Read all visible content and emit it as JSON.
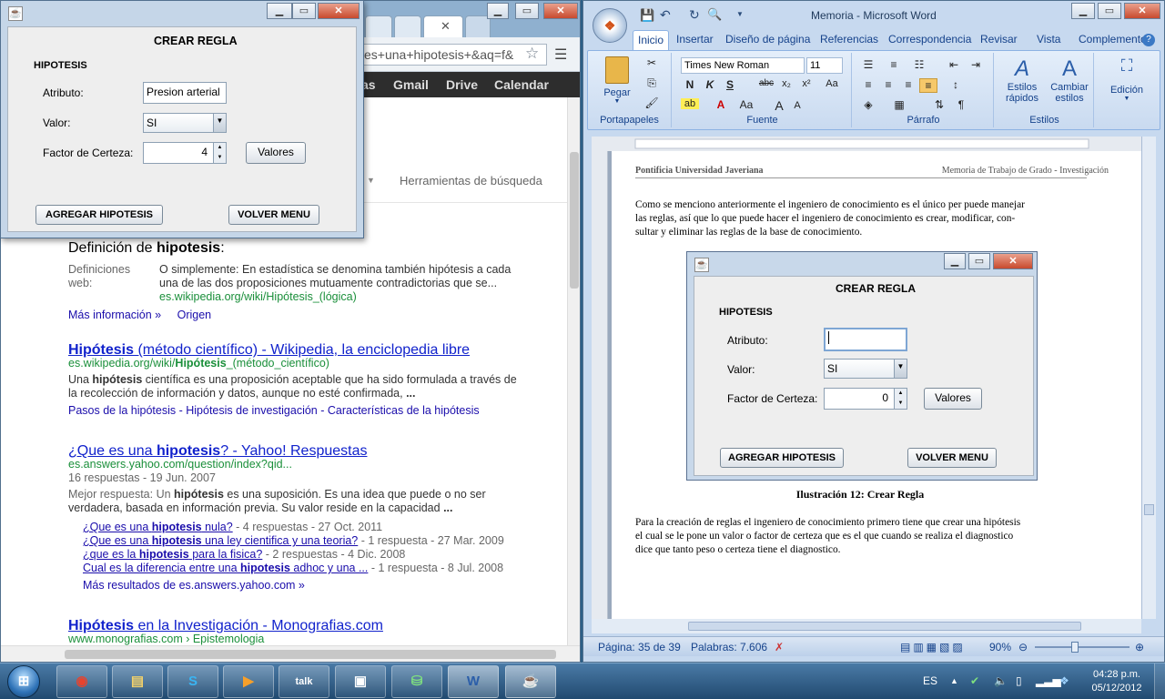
{
  "chrome": {
    "omnibox": "es+una+hipotesis+&aq=f&",
    "gbar": [
      "as",
      "Gmail",
      "Drive",
      "Calendar"
    ],
    "search_tools": "Herramientas de búsqueda",
    "definition": {
      "title_plain": "Definición de ",
      "title_bold": "hipotesis",
      "title_end": ":",
      "label1": "Definiciones",
      "label2": "web:",
      "text_l1": "O simplemente: En estadística se denomina también hipótesis a cada",
      "text_l2": "una de las dos proposiciones mutuamente contradictorias que se...",
      "url": "es.wikipedia.org/wiki/Hipótesis_(lógica)",
      "more": "Más información »",
      "origin": "Origen"
    },
    "result1": {
      "title_bold": "Hipótesis",
      "title_rest": " (método científico) - Wikipedia, la enciclopedia libre",
      "url_pre": "es.wikipedia.org/wiki/",
      "url_bold": "Hipótesis",
      "url_post": "_(método_científico)",
      "snip_l1_pre": "Una ",
      "snip_l1_bold": "hipótesis",
      "snip_l1_post": " científica es una proposición aceptable que ha sido formulada a través de",
      "snip_l2_pre": "la recolección de información y datos, aunque no esté confirmada, ",
      "snip_l2_bold": "...",
      "links": "Pasos de la hipótesis - Hipótesis de investigación - Características de la hipótesis"
    },
    "result2": {
      "title_pre": "¿Que es una ",
      "title_bold": "hipotesis",
      "title_post": "? - Yahoo! Respuestas",
      "url": "es.answers.yahoo.com/question/index?qid...",
      "meta": "16 respuestas - 19 Jun. 2007",
      "best_pre": "Mejor respuesta: Un ",
      "best_bold": "hipótesis",
      "best_post": " es una suposición. Es una idea que puede o no ser",
      "best_l2": "verdadera, basada en información previa. Su valor reside en la capacidad ",
      "best_l2_end": "...",
      "sub": [
        {
          "pre": "¿Que es una ",
          "bold": "hipotesis",
          "post": " nula?",
          "meta": " - 4 respuestas - 27 Oct. 2011"
        },
        {
          "pre": "¿Que es una ",
          "bold": "hipotesis",
          "post": " una ley cientifica y una teoria?",
          "meta": " - 1 respuesta - 27 Mar. 2009"
        },
        {
          "pre": "¿que es la ",
          "bold": "hipotesis",
          "post": " para la fisica?",
          "meta": " - 2 respuestas - 4 Dic. 2008"
        },
        {
          "pre": "Cual es la diferencia entre una ",
          "bold": "hipotesis",
          "post": " adhoc y una ...",
          "meta": " - 1 respuesta - 8 Jul. 2008"
        }
      ],
      "more": "Más resultados de es.answers.yahoo.com »"
    },
    "result3": {
      "title_bold": "Hipótesis",
      "title_rest": " en la Investigación - Monografias.com",
      "url": "www.monografias.com › Epistemologia"
    }
  },
  "dialog": {
    "heading": "CREAR REGLA",
    "section": "HIPOTESIS",
    "attr_label": "Atributo:",
    "attr_value": "Presion arterial",
    "valor_label": "Valor:",
    "valor_value": "SI",
    "factor_label": "Factor de Certeza:",
    "factor_value": "4",
    "valores_btn": "Valores",
    "add_btn": "AGREGAR HIPOTESIS",
    "back_btn": "VOLVER MENU"
  },
  "word": {
    "title": "Memoria - Microsoft Word",
    "tabs": [
      "Inicio",
      "Insertar",
      "Diseño de página",
      "Referencias",
      "Correspondencia",
      "Revisar",
      "Vista",
      "Complementos"
    ],
    "paste": "Pegar",
    "font": "Times New Roman",
    "size": "11",
    "styles_quick": "Estilos",
    "styles_quick2": "rápidos",
    "styles_change": "Cambiar",
    "styles_change2": "estilos",
    "edit": "Edición",
    "groups": [
      "Portapapeles",
      "Fuente",
      "Párrafo",
      "Estilos"
    ],
    "header_left": "Pontificia Universidad Javeriana",
    "header_right": "Memoria de Trabajo de Grado - Investigación",
    "para1": [
      "Como se menciono anteriormente el ingeniero de conocimiento es el único per puede manejar",
      "las reglas, así que lo que puede hacer el ingeniero de conocimiento es crear, modificar, con-",
      "sultar y eliminar las reglas de la base de conocimiento."
    ],
    "figure": {
      "heading": "CREAR REGLA",
      "section": "HIPOTESIS",
      "attr_label": "Atributo:",
      "valor_label": "Valor:",
      "valor_value": "SI",
      "factor_label": "Factor de Certeza:",
      "factor_value": "0",
      "valores_btn": "Valores",
      "add_btn": "AGREGAR HIPOTESIS",
      "back_btn": "VOLVER MENU"
    },
    "caption": "Ilustración 12: Crear Regla",
    "para2": [
      "Para la creación de reglas el ingeniero de conocimiento primero tiene que crear una hipótesis",
      "el cual se le pone un valor o factor de certeza que es el que cuando se realiza el diagnostico",
      "dice que tanto peso o certeza tiene el diagnostico."
    ],
    "status_page": "Página: 35 de 39",
    "status_words": "Palabras: 7.606",
    "zoom": "90%"
  },
  "taskbar": {
    "lang": "ES",
    "time": "04:28 p.m.",
    "date": "05/12/2012"
  }
}
